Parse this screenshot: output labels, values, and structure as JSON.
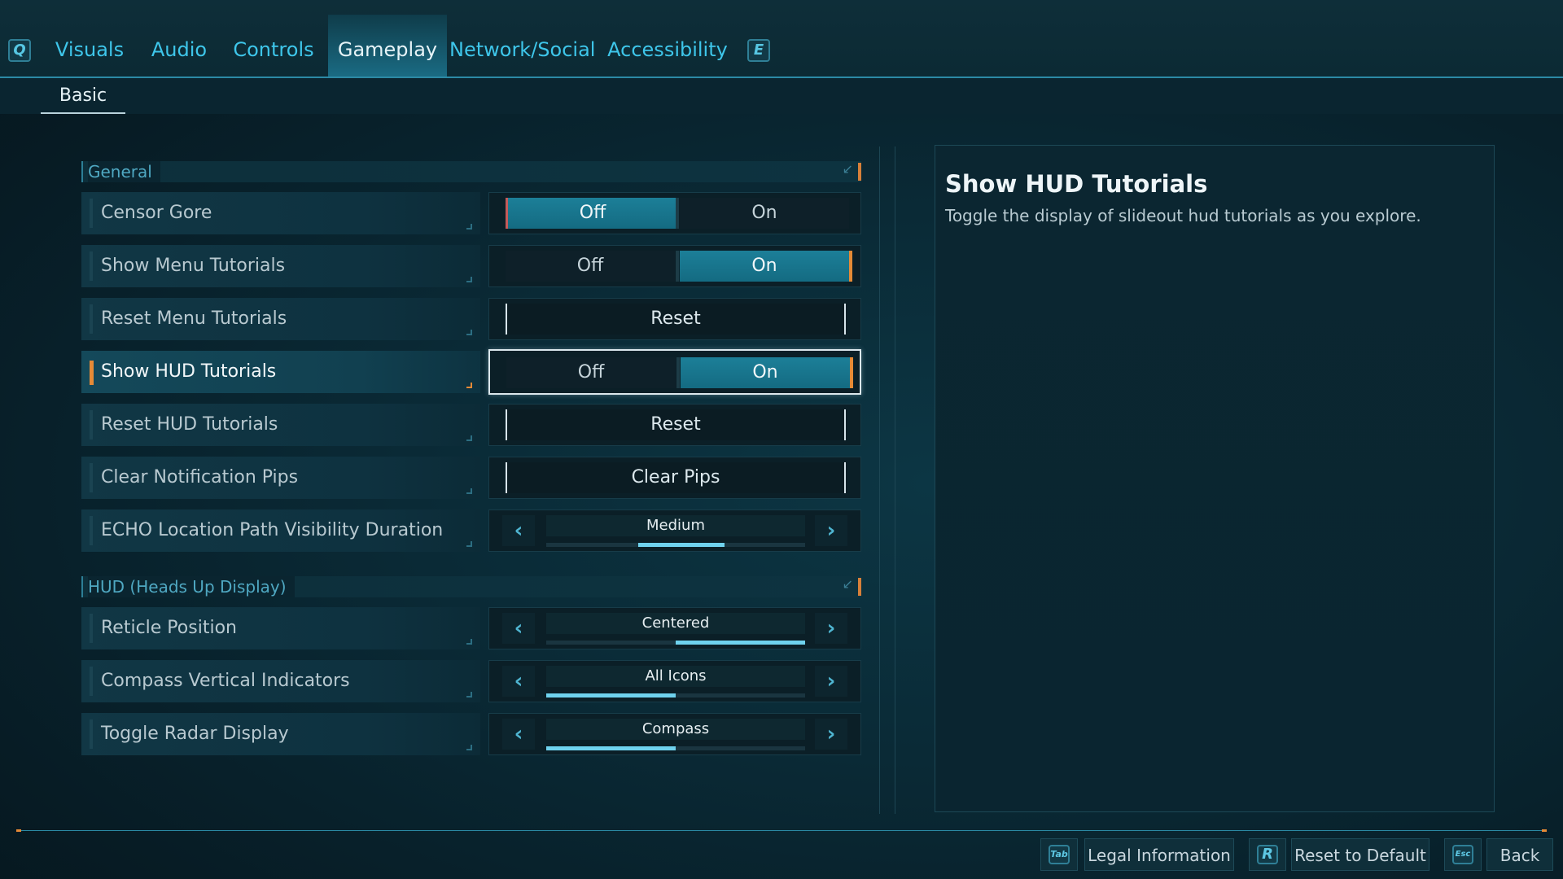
{
  "tabs": {
    "prev_key": "Q",
    "next_key": "E",
    "items": [
      "Visuals",
      "Audio",
      "Controls",
      "Gameplay",
      "Network/Social",
      "Accessibility"
    ],
    "active": "Gameplay"
  },
  "subtabs": {
    "active": "Basic"
  },
  "sections": [
    {
      "title": "General",
      "rows": [
        {
          "label": "Censor Gore",
          "type": "toggle",
          "off": "Off",
          "on": "On",
          "value": "Off"
        },
        {
          "label": "Show Menu Tutorials",
          "type": "toggle",
          "off": "Off",
          "on": "On",
          "value": "On"
        },
        {
          "label": "Reset Menu Tutorials",
          "type": "button",
          "button": "Reset"
        },
        {
          "label": "Show HUD Tutorials",
          "type": "toggle",
          "off": "Off",
          "on": "On",
          "value": "On",
          "focused": true
        },
        {
          "label": "Reset HUD Tutorials",
          "type": "button",
          "button": "Reset"
        },
        {
          "label": "Clear Notification Pips",
          "type": "button",
          "button": "Clear Pips"
        },
        {
          "label": "ECHO Location Path Visibility Duration",
          "type": "selector",
          "value": "Medium"
        }
      ]
    },
    {
      "title": "HUD (Heads Up Display)",
      "rows": [
        {
          "label": "Reticle Position",
          "type": "selector",
          "value": "Centered"
        },
        {
          "label": "Compass Vertical Indicators",
          "type": "selector",
          "value": "All Icons"
        },
        {
          "label": "Toggle Radar Display",
          "type": "selector",
          "value": "Compass"
        }
      ]
    }
  ],
  "description": {
    "title": "Show HUD Tutorials",
    "text": "Toggle the display of slideout hud tutorials as you explore."
  },
  "footer": {
    "legal": {
      "key": "Tab",
      "label": "Legal Information"
    },
    "reset": {
      "key": "R",
      "label": "Reset to Default"
    },
    "back": {
      "key": "Esc",
      "label": "Back"
    }
  },
  "colors": {
    "accent": "#3ec6ea",
    "selected": "#1c7f98",
    "focus_marker": "#e58a36"
  }
}
